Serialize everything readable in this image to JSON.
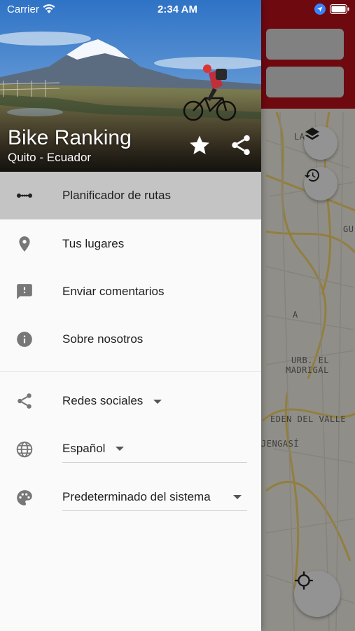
{
  "status_bar": {
    "carrier": "Carrier",
    "time": "2:34 AM"
  },
  "header": {
    "title": "Bike Ranking",
    "subtitle": "Quito - Ecuador",
    "star_icon": "star-icon",
    "share_icon": "share-icon"
  },
  "menu": {
    "items": [
      {
        "label": "Planificador de rutas",
        "icon": "route-dots-icon",
        "active": true
      },
      {
        "label": "Tus lugares",
        "icon": "location-pin-icon",
        "active": false
      },
      {
        "label": "Enviar comentarios",
        "icon": "feedback-icon",
        "active": false
      },
      {
        "label": "Sobre nosotros",
        "icon": "info-icon",
        "active": false
      }
    ]
  },
  "settings": {
    "social": {
      "label": "Redes sociales",
      "icon": "share-icon"
    },
    "language": {
      "value": "Español",
      "icon": "globe-icon"
    },
    "theme": {
      "value": "Predeterminado del sistema",
      "icon": "palette-icon"
    }
  },
  "map": {
    "labels": [
      "LA",
      "GU",
      "A",
      "URB. EL",
      "MADRIGAL",
      "EDEN DEL VALLE",
      "JENGASÍ"
    ],
    "buttons": [
      "layers-icon",
      "history-icon",
      "my-location-icon"
    ]
  },
  "colors": {
    "accent": "#b8101c",
    "active_item": "#c4c4c4",
    "drawer_bg": "#fafafa"
  }
}
